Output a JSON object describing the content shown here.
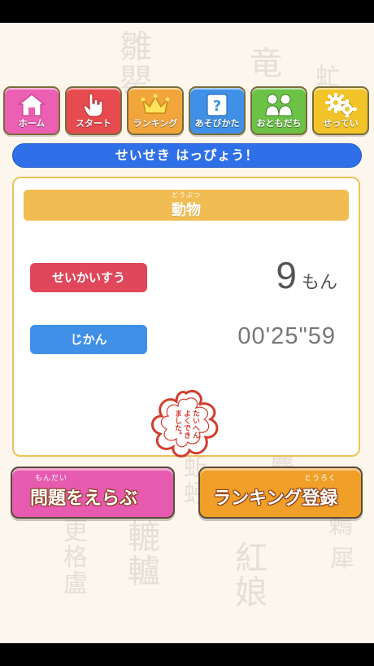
{
  "nav": {
    "items": [
      {
        "label": "ホーム",
        "icon": "home-icon",
        "color": "#ec5fb2"
      },
      {
        "label": "スタート",
        "icon": "pointing-hand-icon",
        "color": "#e74b50"
      },
      {
        "label": "ランキング",
        "icon": "crown-icon",
        "color": "#f2a53a"
      },
      {
        "label": "あそびかた",
        "icon": "question-icon",
        "color": "#3f90e6"
      },
      {
        "label": "おともだち",
        "icon": "friends-icon",
        "color": "#6cc247"
      },
      {
        "label": "せってい",
        "icon": "gears-icon",
        "color": "#f2c42a"
      }
    ]
  },
  "result": {
    "header": "せいせき はっぴょう！",
    "category_ruby": "どうぶつ",
    "category": "動物",
    "score_label": "せいかいすう",
    "score_value": "9",
    "score_unit": "もん",
    "time_label": "じかん",
    "time_value": "00'25\"59",
    "stamp_text": [
      "たいへん",
      "よくでき",
      "ました。"
    ]
  },
  "actions": {
    "choose_ruby": "もんだい",
    "choose_label": "問題をえらぶ",
    "rank_ruby": "とうろく",
    "rank_label": "ランキング登録"
  },
  "background_kanji": [
    "雛罌",
    "竜",
    "虻",
    "紅娘",
    "轆轤",
    "更格盧",
    "蚯蚓",
    "麝香",
    "鶫",
    "犀"
  ],
  "colors": {
    "accent_blue": "#2f6fe8",
    "score_red": "#e0475a",
    "time_blue": "#3f90e6",
    "category_gold": "#f1bd52",
    "stamp_red": "#d23c2e",
    "choose_pink": "#e65bb0",
    "rank_orange": "#f0a028"
  }
}
